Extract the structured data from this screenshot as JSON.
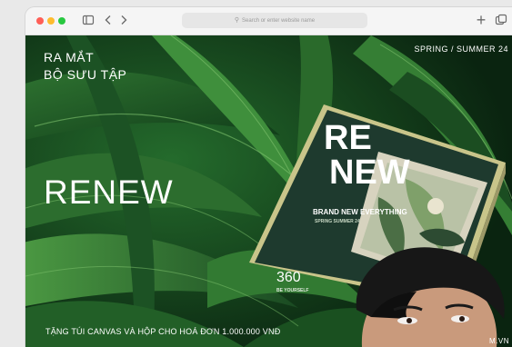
{
  "browser": {
    "url_placeholder": "Search or enter website name",
    "icons": [
      "sidebar-icon",
      "back-icon",
      "forward-icon",
      "search-icon",
      "new-tab-icon",
      "tabs-overview-icon"
    ]
  },
  "hero": {
    "headline_line1": "RA MẮT",
    "headline_line2": "BỘ SƯU TẬP",
    "season": "SPRING / SUMMER 24",
    "collection_name": "RENEW",
    "promo": "TẶNG TÚI CANVAS VÀ HỘP CHO HOÁ ĐƠN 1.000.000 VNĐ",
    "site": "M.VN"
  },
  "product_box": {
    "title_line1": "RE",
    "title_line2": "NEW",
    "tagline": "BRAND NEW EVERYTHING",
    "subtag": "SPRING SUMMER 24",
    "logo": "360",
    "logo_sub": "BE YOURSELF"
  },
  "colors": {
    "leaf_dark": "#0d2a14",
    "leaf_mid": "#1f5a2a",
    "leaf_light": "#3b8a3c",
    "box_green": "#1e3a2e",
    "box_edge": "#c9c58a"
  }
}
